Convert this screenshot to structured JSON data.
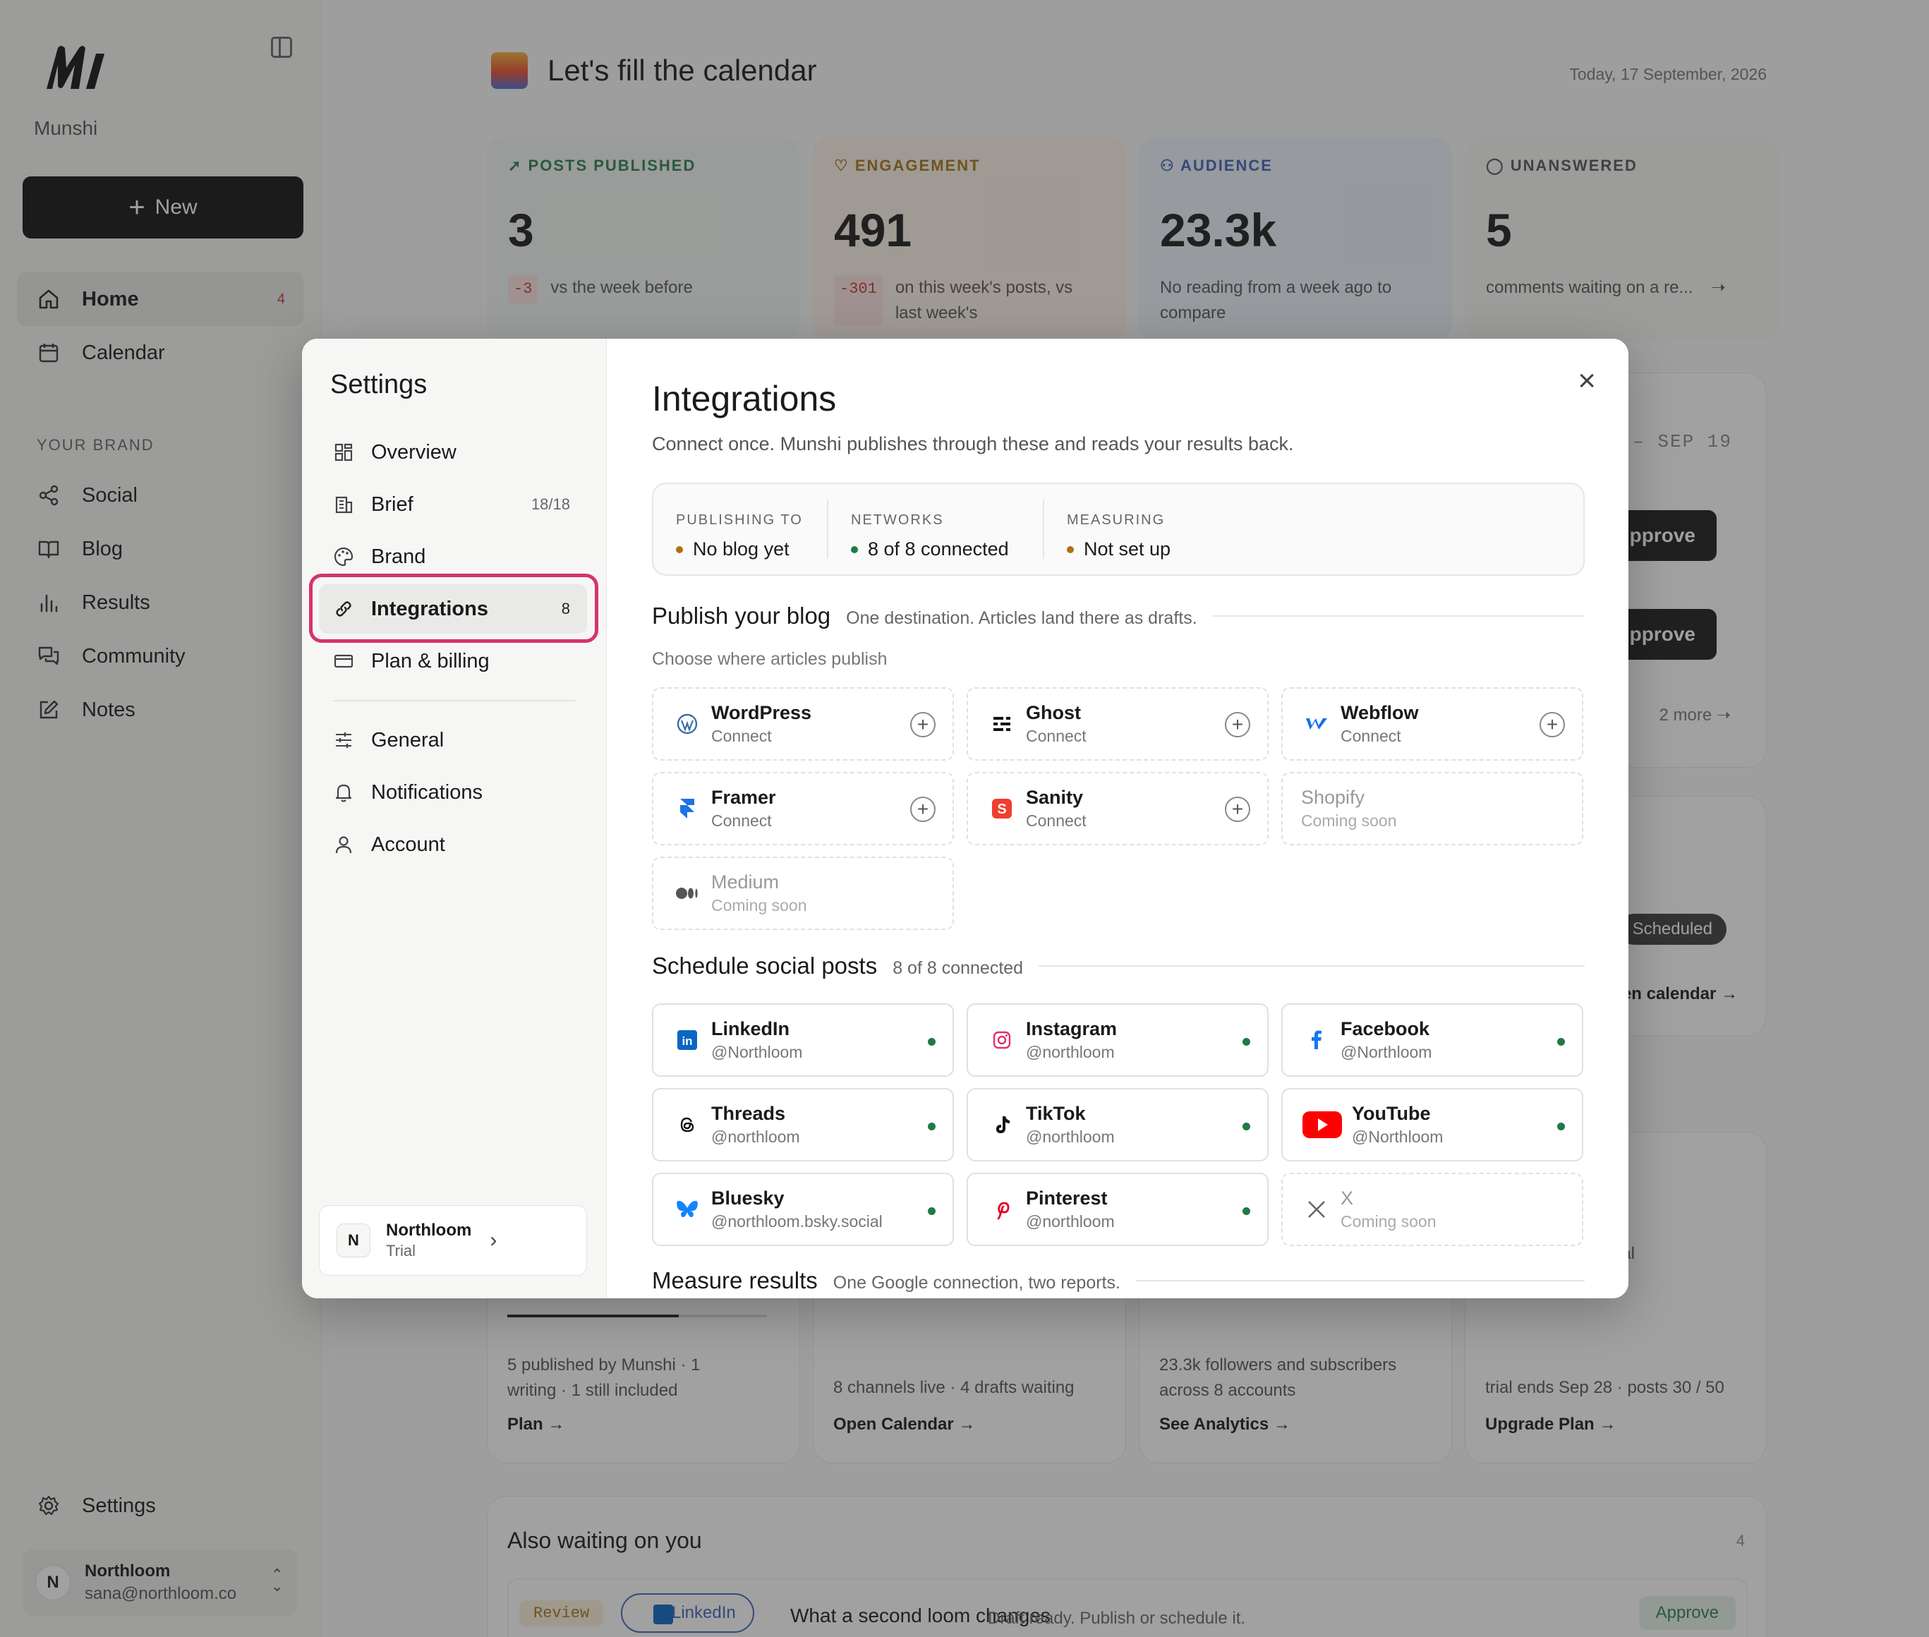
{
  "sidebar": {
    "brand": "Munshi",
    "new_label": "New",
    "nav": [
      {
        "label": "Home",
        "badge": "4"
      },
      {
        "label": "Calendar"
      }
    ],
    "section_label": "YOUR BRAND",
    "brand_nav": [
      "Social",
      "Blog",
      "Results",
      "Community",
      "Notes"
    ],
    "settings_label": "Settings",
    "user": {
      "initial": "N",
      "name": "Northloom",
      "email": "sana@northloom.co"
    }
  },
  "main": {
    "title": "Let's fill the calendar",
    "date": "Today, 17 September, 2026",
    "stats": [
      {
        "label": "POSTS PUBLISHED",
        "value": "3",
        "delta": "-3",
        "sub": "vs the week before",
        "color": "#2e7d4f"
      },
      {
        "label": "ENGAGEMENT",
        "value": "491",
        "delta": "-301",
        "sub": "on this week's posts, vs last week's",
        "color": "#a8741a"
      },
      {
        "label": "AUDIENCE",
        "value": "23.3k",
        "sub": "No reading from a week ago to compare",
        "color": "#3d63b8"
      },
      {
        "label": "UNANSWERED",
        "value": "5",
        "sub": "comments waiting on a re...",
        "color": "#555555"
      }
    ],
    "week_range": "– SEP 19",
    "approve_label": "pprove",
    "more_label": "2 more",
    "scheduled_label": "Scheduled",
    "open_calendar_partial": "en calendar →",
    "trial_partial": "ial",
    "cards": [
      {
        "text": "5 published by Munshi · 1 writing · 1 still included",
        "link": "Plan →"
      },
      {
        "text": "8 channels live · 4 drafts waiting",
        "link": "Open Calendar →"
      },
      {
        "text": "23.3k followers and subscribers across 8 accounts",
        "link": "See Analytics →"
      },
      {
        "text": "trial ends Sep 28 · posts 30 / 50",
        "link": "Upgrade Plan →"
      }
    ],
    "waiting": {
      "title": "Also waiting on you",
      "count": "4",
      "chip": "Review",
      "network": "LinkedIn",
      "item_title": "What a second loom changes",
      "item_desc": "Draft ready. Publish or schedule it.",
      "action": "Approve"
    }
  },
  "settings": {
    "title": "Settings",
    "items": [
      {
        "label": "Overview"
      },
      {
        "label": "Brief",
        "count": "18/18"
      },
      {
        "label": "Brand"
      },
      {
        "label": "Integrations",
        "count": "8"
      },
      {
        "label": "Plan & billing"
      },
      {
        "label": "General"
      },
      {
        "label": "Notifications"
      },
      {
        "label": "Account"
      }
    ],
    "org": {
      "initial": "N",
      "name": "Northloom",
      "plan": "Trial"
    }
  },
  "integrations": {
    "title": "Integrations",
    "description": "Connect once. Munshi publishes through these and reads your results back.",
    "summary": [
      {
        "label": "PUBLISHING TO",
        "value": "No blog yet",
        "dot": "#b06f12"
      },
      {
        "label": "NETWORKS",
        "value": "8 of 8 connected",
        "dot": "#1f7a44"
      },
      {
        "label": "MEASURING",
        "value": "Not set up",
        "dot": "#b06f12"
      }
    ],
    "blog": {
      "title": "Publish your blog",
      "subtitle": "One destination. Articles land there as drafts.",
      "choose": "Choose where articles publish",
      "tiles": [
        {
          "name": "WordPress",
          "sub": "Connect"
        },
        {
          "name": "Ghost",
          "sub": "Connect"
        },
        {
          "name": "Webflow",
          "sub": "Connect"
        },
        {
          "name": "Framer",
          "sub": "Connect"
        },
        {
          "name": "Sanity",
          "sub": "Connect"
        },
        {
          "name": "Shopify",
          "sub": "Coming soon"
        },
        {
          "name": "Medium",
          "sub": "Coming soon"
        }
      ]
    },
    "social": {
      "title": "Schedule social posts",
      "subtitle": "8 of 8 connected",
      "tiles": [
        {
          "name": "LinkedIn",
          "handle": "@Northloom"
        },
        {
          "name": "Instagram",
          "handle": "@northloom"
        },
        {
          "name": "Facebook",
          "handle": "@Northloom"
        },
        {
          "name": "Threads",
          "handle": "@northloom"
        },
        {
          "name": "TikTok",
          "handle": "@northloom"
        },
        {
          "name": "YouTube",
          "handle": "@Northloom"
        },
        {
          "name": "Bluesky",
          "handle": "@northloom.bsky.social"
        },
        {
          "name": "Pinterest",
          "handle": "@northloom"
        },
        {
          "name": "X",
          "handle": "Coming soon"
        }
      ]
    },
    "measure": {
      "title": "Measure results",
      "subtitle": "One Google connection, two reports."
    }
  }
}
